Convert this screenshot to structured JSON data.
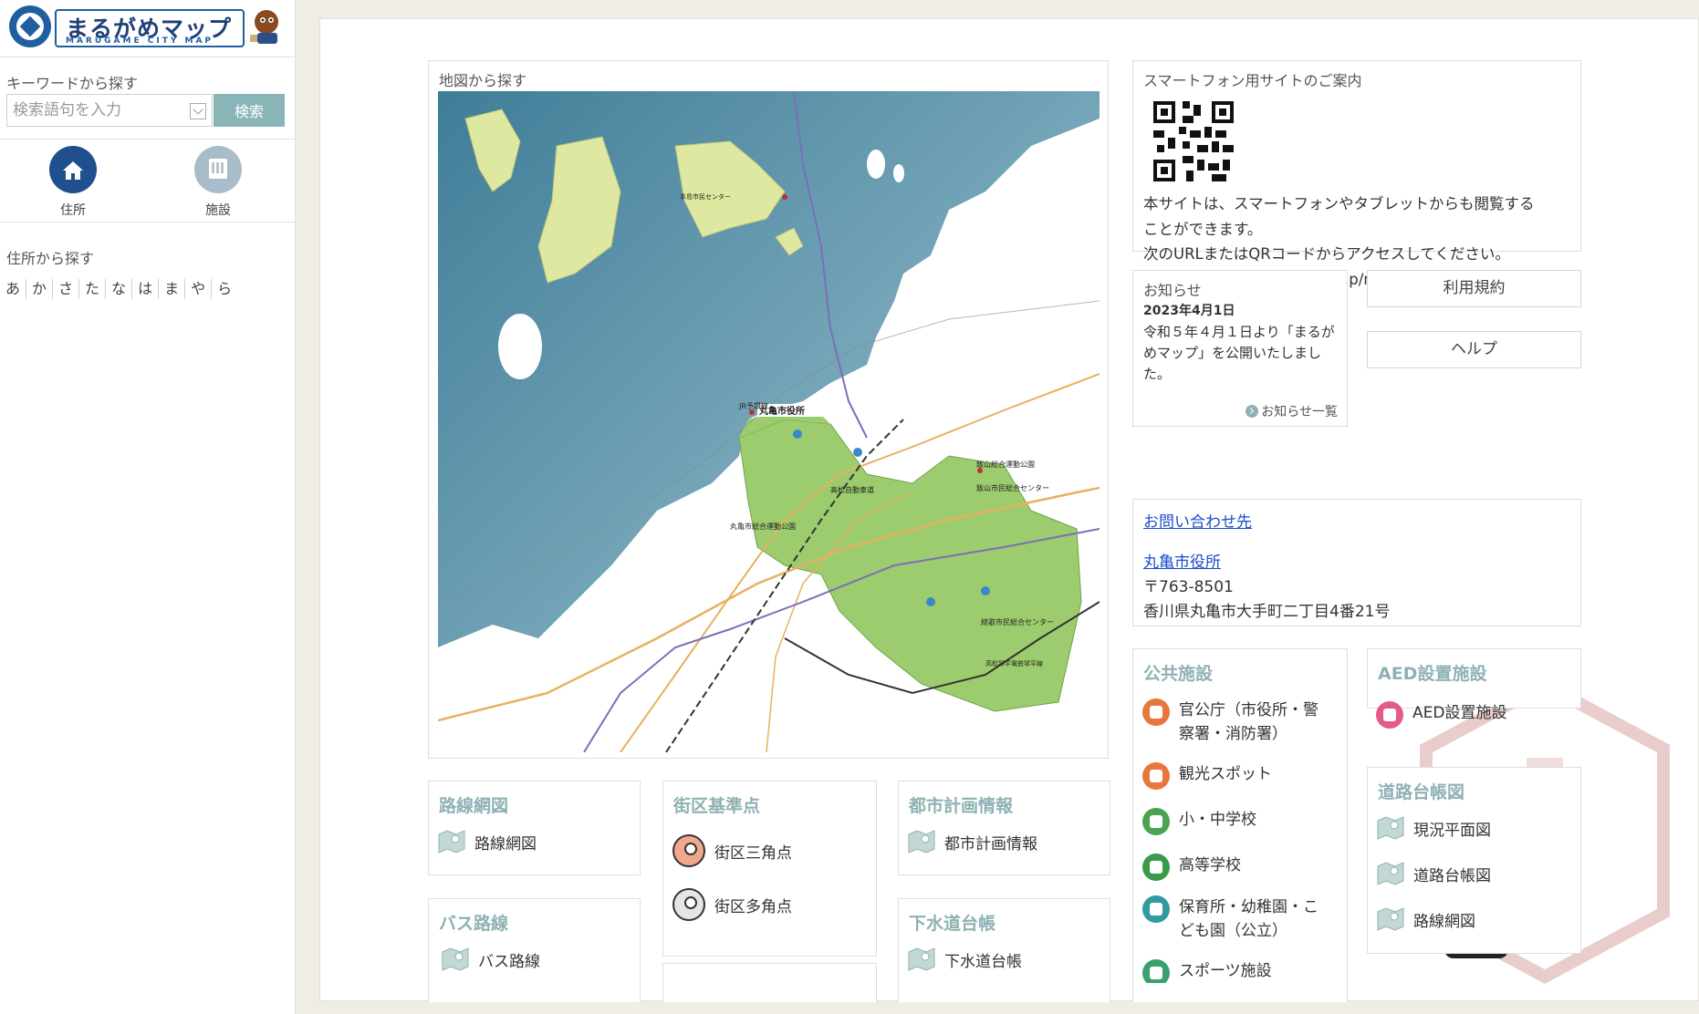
{
  "sidebar": {
    "logo_title": "まるがめマップ",
    "logo_sub": "MARUGAME CITY MAP",
    "keyword_label": "キーワードから探す",
    "keyword_placeholder": "検索語句を入力",
    "search_button": "検索",
    "modes": [
      {
        "label": "住所",
        "icon": "home-icon",
        "color": "#1f4f8f"
      },
      {
        "label": "施設",
        "icon": "building-icon",
        "color": "#a9bcc9"
      }
    ],
    "address_label": "住所から探す",
    "kana": [
      "あ",
      "か",
      "さ",
      "た",
      "な",
      "は",
      "ま",
      "や",
      "ら"
    ]
  },
  "map_panel": {
    "title": "地図から探す",
    "labels": {
      "city_hall": "丸亀市役所",
      "jr_line": "JR予讃線",
      "expressway": "高松自動車道",
      "iiyama_park": "飯山総合運動公園",
      "iiyama_center": "飯山市民総合センター",
      "sports_park": "丸亀市総合運動公園",
      "ayauta_center": "綾歌市民総合センター",
      "honjima": "本島市民センター",
      "kotoden": "高松琴平電鉄琴平線"
    }
  },
  "smartphone": {
    "title": "スマートフォン用サイトのご案内",
    "lines": [
      "本サイトは、スマートフォンやタブレットからも閲覧する",
      "ことができます。",
      "次のURLまたはQRコードからアクセスしてください。",
      "https://www.sonicweb-asp.jp/marugame/"
    ]
  },
  "news": {
    "title": "お知らせ",
    "date": "2023年4月1日",
    "body": "令和５年４月１日より「まるがめマップ」を公開いたしました。",
    "more": "お知らせ一覧"
  },
  "buttons": {
    "terms": "利用規約",
    "help": "ヘルプ"
  },
  "contact": {
    "link": "お問い合わせ先",
    "office": "丸亀市役所",
    "postal": "〒763-8501",
    "address": "香川県丸亀市大手町二丁目4番21号"
  },
  "public_facilities": {
    "title": "公共施設",
    "items": [
      {
        "label": "官公庁（市役所・警察署・消防署）",
        "color": "#e8763f"
      },
      {
        "label": "観光スポット",
        "color": "#e8763f"
      },
      {
        "label": "小・中学校",
        "color": "#4aa351"
      },
      {
        "label": "高等学校",
        "color": "#3a9a4a"
      },
      {
        "label": "保育所・幼稚園・こども園（公立）",
        "color": "#2f9aa0"
      },
      {
        "label": "スポーツ施設",
        "color": "#3aa070"
      }
    ]
  },
  "aed": {
    "title": "AED設置施設",
    "item": "AED設置施設",
    "color": "#e45a8a"
  },
  "road_ledger": {
    "title": "道路台帳図",
    "items": [
      "現況平面図",
      "道路台帳図",
      "路線網図"
    ]
  },
  "route_map": {
    "title": "路線網図",
    "item": "路線網図"
  },
  "block_points": {
    "title": "街区基準点",
    "items": [
      "街区三角点",
      "街区多角点"
    ]
  },
  "city_planning": {
    "title": "都市計画情報",
    "item": "都市計画情報"
  },
  "bus": {
    "title": "バス路線",
    "item": "バス路線"
  },
  "sewer": {
    "title": "下水道台帳",
    "item": "下水道台帳"
  },
  "colors": {
    "accent_teal": "#8fb1b4",
    "sea": "#4f8fa8",
    "land_green": "#9ccc6e",
    "island": "#dfe8a0"
  }
}
